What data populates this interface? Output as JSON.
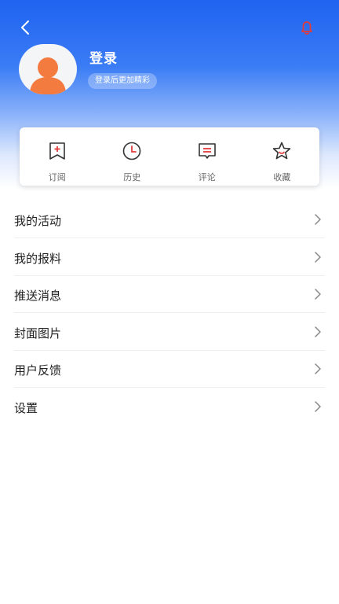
{
  "header": {
    "login_title": "登录",
    "login_hint": "登录后更加精彩"
  },
  "icons": {
    "back": "chevron-left-icon",
    "notify": "bell-icon",
    "avatar": "user-avatar-icon"
  },
  "quick_actions": [
    {
      "label": "订阅",
      "icon": "bookmark-plus-icon"
    },
    {
      "label": "历史",
      "icon": "clock-icon"
    },
    {
      "label": "评论",
      "icon": "comment-icon"
    },
    {
      "label": "收藏",
      "icon": "star-icon"
    }
  ],
  "menu": [
    {
      "label": "我的活动"
    },
    {
      "label": "我的报料"
    },
    {
      "label": "推送消息"
    },
    {
      "label": "封面图片"
    },
    {
      "label": "用户反馈"
    },
    {
      "label": "设置"
    }
  ],
  "colors": {
    "brand_blue": "#1f63f0",
    "icon_red": "#e23b3b",
    "avatar_orange": "#f47b3f"
  }
}
